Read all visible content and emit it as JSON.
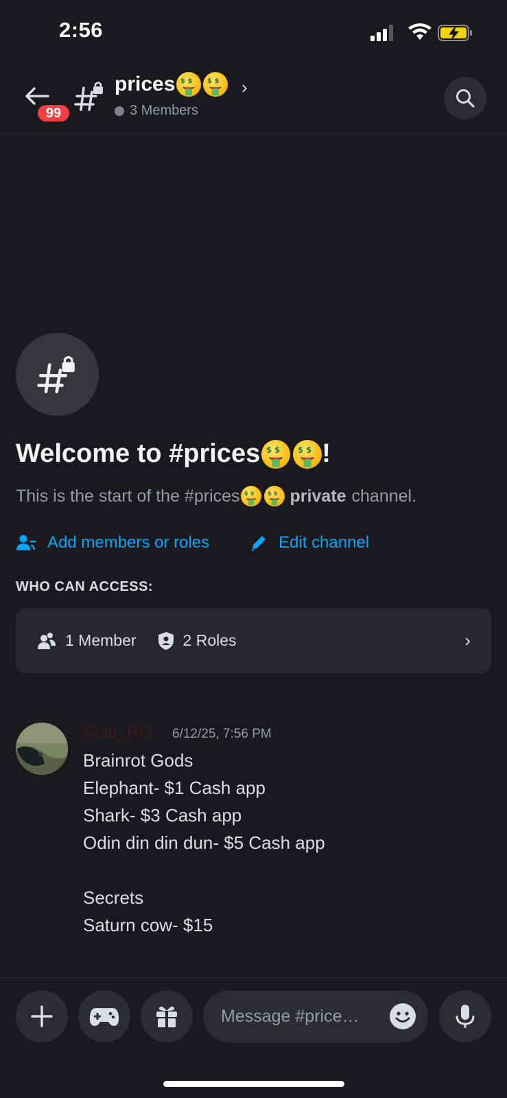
{
  "status_bar": {
    "time": "2:56"
  },
  "header": {
    "back_badge": "99",
    "channel_name": "prices",
    "channel_emoji": [
      "money-mouth-face",
      "money-mouth-face"
    ],
    "members": "3 Members"
  },
  "welcome": {
    "title_prefix": "Welcome to #prices",
    "title_suffix": "!",
    "sub_prefix": "This is the start of the #prices",
    "sub_bold": "private",
    "sub_suffix": "channel.",
    "add_members": "Add members or roles",
    "edit_channel": "Edit channel",
    "access_label": "WHO CAN ACCESS:",
    "access_members": "1 Member",
    "access_roles": "2 Roles"
  },
  "message": {
    "author": "Solo_RG",
    "timestamp": "6/12/25, 7:56 PM",
    "body": "Brainrot Gods\nElephant- $1 Cash app\nShark- $3 Cash app\nOdin din din dun- $5 Cash app\n\nSecrets\nSaturn cow- $15"
  },
  "composer": {
    "placeholder": "Message #price…"
  },
  "colors": {
    "accent_link": "#00a8fc",
    "badge_red": "#f23f43",
    "background": "#1a1a1e"
  }
}
